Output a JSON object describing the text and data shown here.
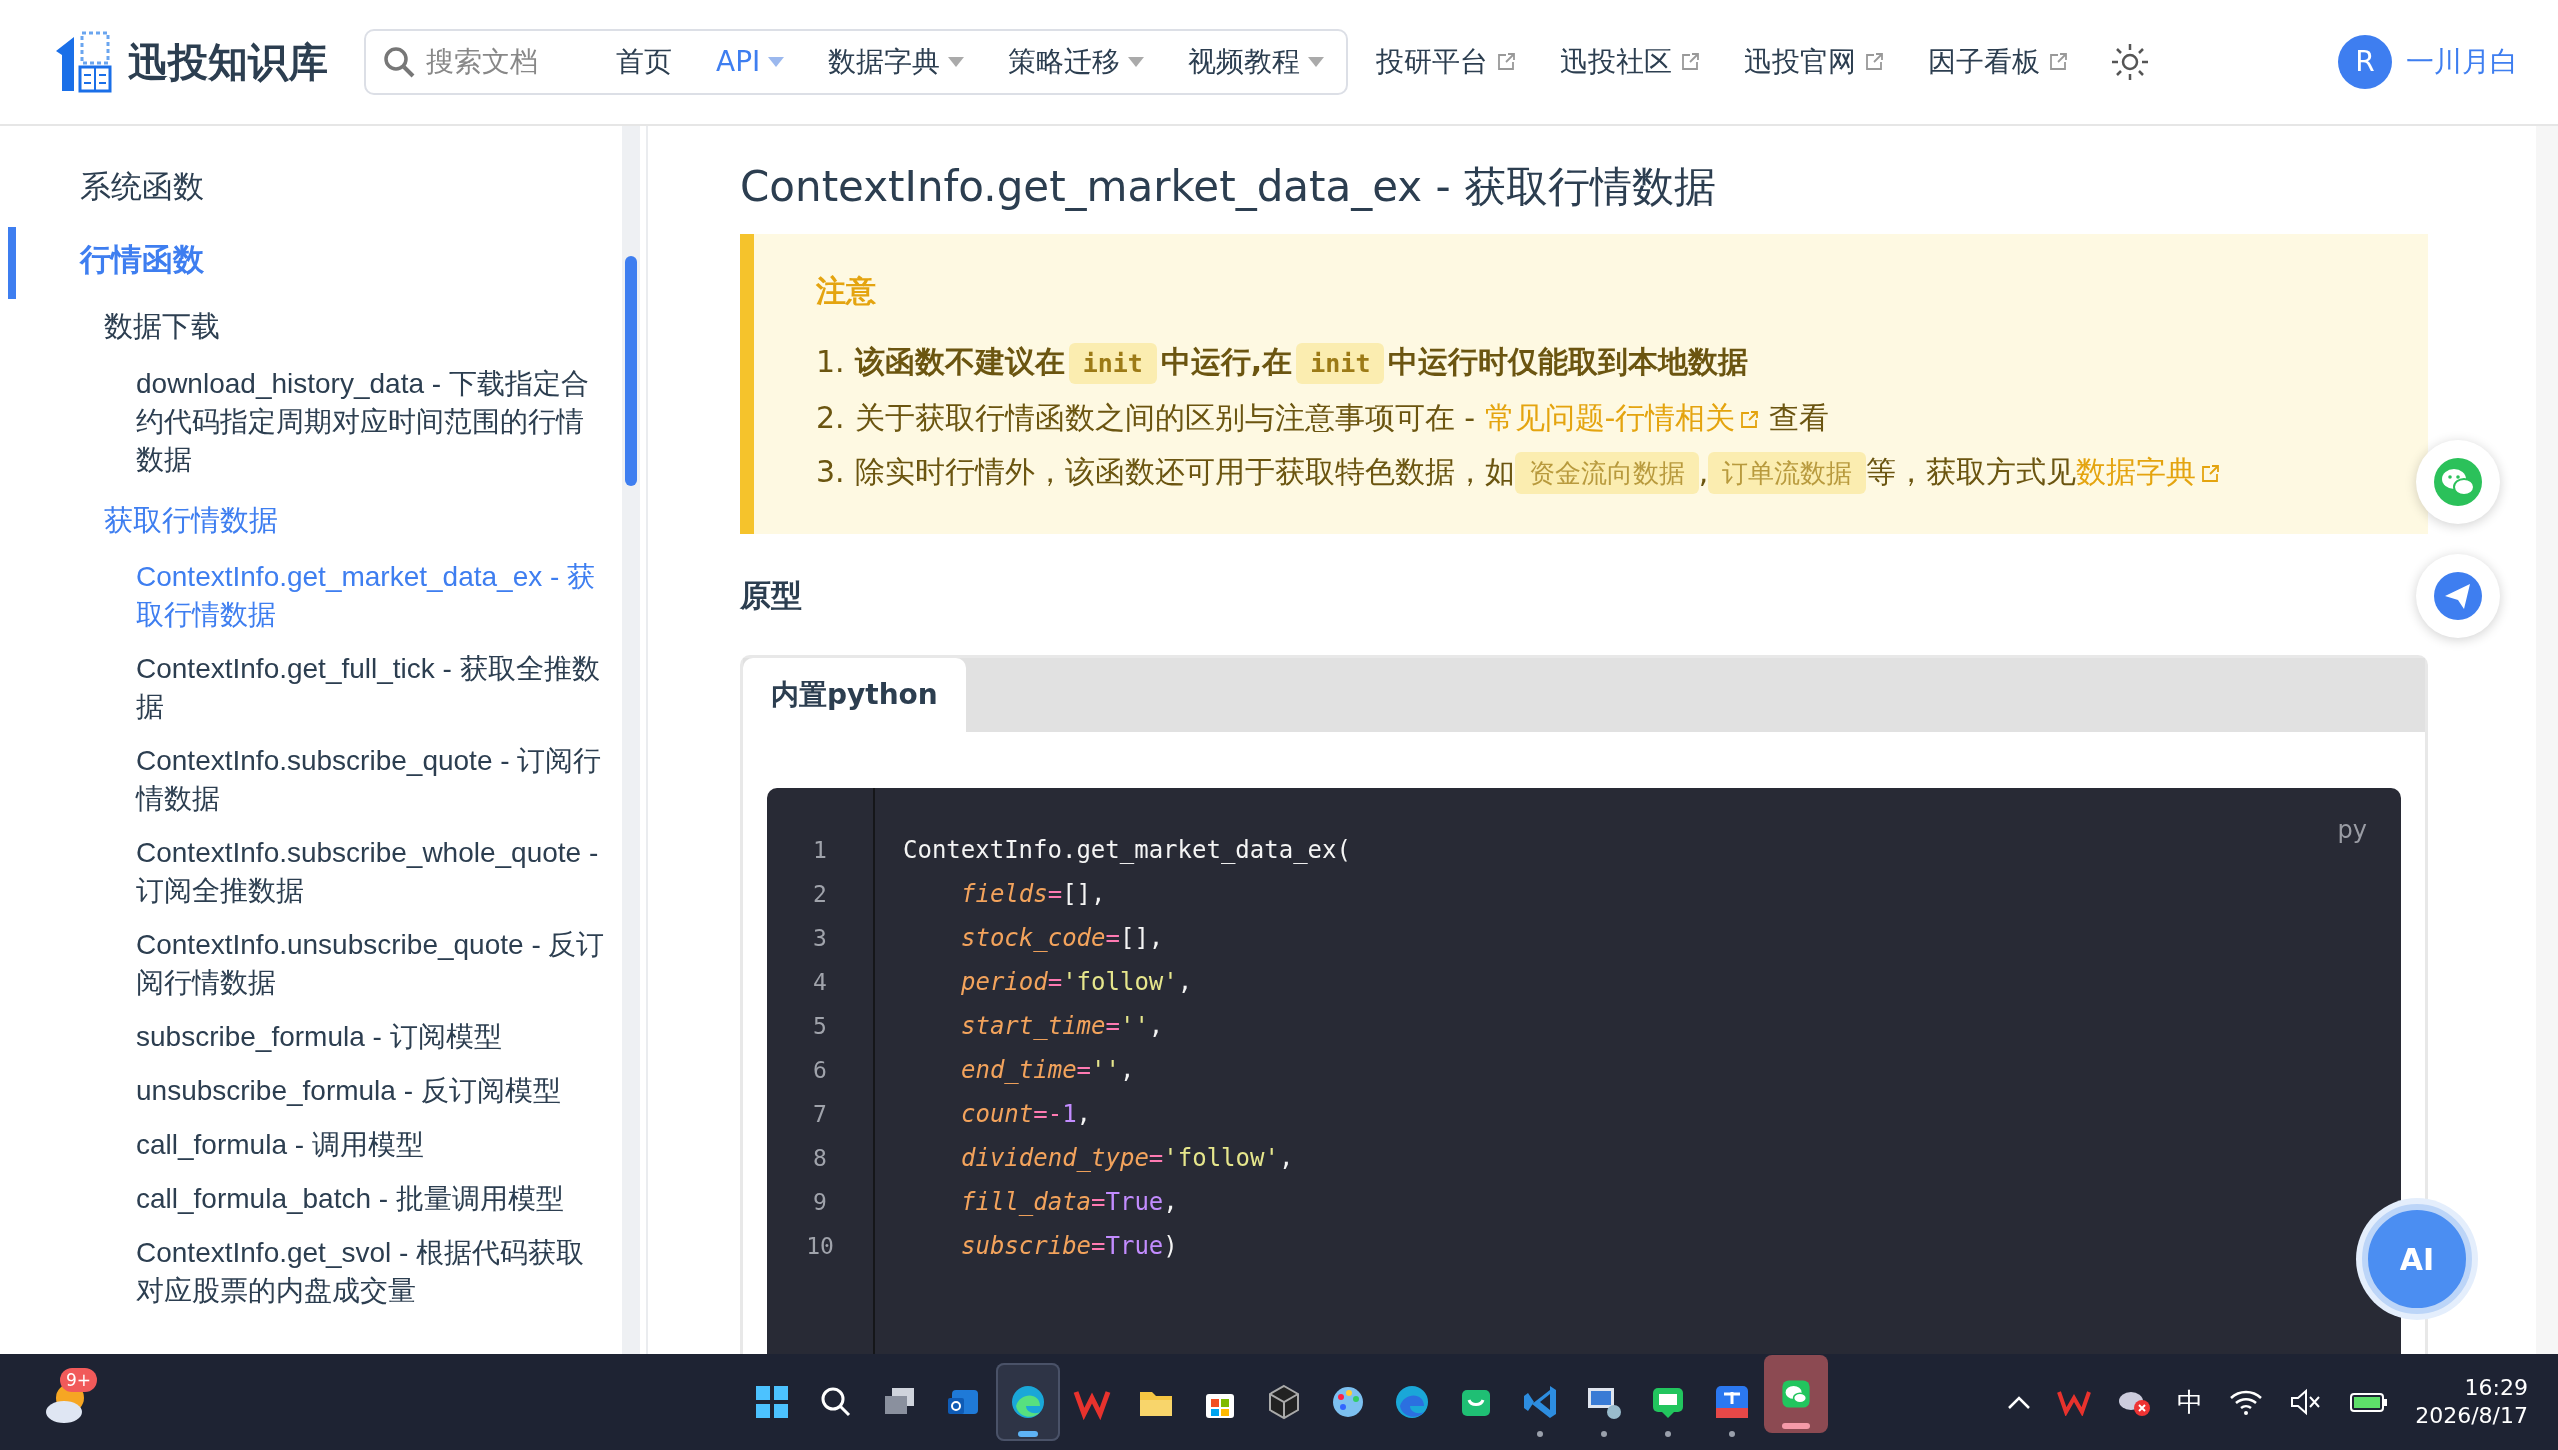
{
  "header": {
    "logo_text": "迅投知识库",
    "search": {
      "placeholder": "搜索文档"
    },
    "nav": [
      {
        "label": "首页",
        "kind": "plain",
        "selected": false
      },
      {
        "label": "API",
        "kind": "dropdown",
        "selected": true
      },
      {
        "label": "数据字典",
        "kind": "dropdown",
        "selected": false
      },
      {
        "label": "策略迁移",
        "kind": "dropdown",
        "selected": false
      },
      {
        "label": "视频教程",
        "kind": "dropdown",
        "selected": false
      },
      {
        "label": "投研平台",
        "kind": "external",
        "selected": false
      },
      {
        "label": "迅投社区",
        "kind": "external",
        "selected": false
      },
      {
        "label": "迅投官网",
        "kind": "external",
        "selected": false
      },
      {
        "label": "因子看板",
        "kind": "external",
        "selected": false
      }
    ],
    "user": {
      "avatar": "R",
      "name": "一川月白"
    }
  },
  "sidebar": {
    "items": [
      {
        "label": "系统函数",
        "selected": false
      },
      {
        "label": "行情函数",
        "selected": true,
        "children": [
          {
            "label": "数据下载",
            "selected": false,
            "children": [
              {
                "label": "download_history_data - 下载指定合约代码指定周期对应时间范围的行情数据",
                "selected": false
              }
            ]
          },
          {
            "label": "获取行情数据",
            "selected": true,
            "children": [
              {
                "label": "ContextInfo.get_market_data_ex - 获取行情数据",
                "selected": true
              },
              {
                "label": "ContextInfo.get_full_tick - 获取全推数据",
                "selected": false
              },
              {
                "label": "ContextInfo.subscribe_quote - 订阅行情数据",
                "selected": false
              },
              {
                "label": "ContextInfo.subscribe_whole_quote - 订阅全推数据",
                "selected": false
              },
              {
                "label": "ContextInfo.unsubscribe_quote - 反订阅行情数据",
                "selected": false
              },
              {
                "label": "subscribe_formula - 订阅模型",
                "selected": false
              },
              {
                "label": "unsubscribe_formula - 反订阅模型",
                "selected": false
              },
              {
                "label": "call_formula - 调用模型",
                "selected": false
              },
              {
                "label": "call_formula_batch - 批量调用模型",
                "selected": false
              },
              {
                "label": "ContextInfo.get_svol - 根据代码获取对应股票的内盘成交量",
                "selected": false
              }
            ]
          }
        ]
      }
    ]
  },
  "main": {
    "title": "ContextInfo.get_market_data_ex - 获取行情数据",
    "notice": {
      "title": "注意",
      "items": [
        {
          "number": "1.",
          "bold": true,
          "segments": [
            {
              "kind": "text",
              "text": "该函数不建议在"
            },
            {
              "kind": "code",
              "text": "init"
            },
            {
              "kind": "text",
              "text": "中运行,在"
            },
            {
              "kind": "code",
              "text": "init"
            },
            {
              "kind": "text",
              "text": "中运行时仅能取到本地数据"
            }
          ]
        },
        {
          "number": "2.",
          "bold": false,
          "segments": [
            {
              "kind": "text",
              "text": "关于获取行情函数之间的区别与注意事项可在 - "
            },
            {
              "kind": "link",
              "text": "常见问题-行情相关"
            },
            {
              "kind": "text",
              "text": " 查看"
            }
          ]
        },
        {
          "number": "3.",
          "bold": false,
          "segments": [
            {
              "kind": "text",
              "text": "除实时行情外，该函数还可用于获取特色数据，如"
            },
            {
              "kind": "tag",
              "text": "资金流向数据"
            },
            {
              "kind": "text",
              "text": ","
            },
            {
              "kind": "tag",
              "text": "订单流数据"
            },
            {
              "kind": "text",
              "text": "等，获取方式见"
            },
            {
              "kind": "link",
              "text": "数据字典"
            }
          ]
        }
      ]
    },
    "section_heading": "原型",
    "code_tabs": [
      {
        "label": "内置python",
        "selected": true
      }
    ],
    "code": {
      "lang": "py",
      "lines": [
        {
          "number": "1",
          "tokens": [
            {
              "kind": "plain",
              "text": "ContextInfo.get_market_data_ex("
            }
          ]
        },
        {
          "number": "2",
          "tokens": [
            {
              "kind": "param",
              "text": "fields"
            },
            {
              "kind": "op",
              "text": "="
            },
            {
              "kind": "plain",
              "text": "[],"
            }
          ]
        },
        {
          "number": "3",
          "tokens": [
            {
              "kind": "param",
              "text": "stock_code"
            },
            {
              "kind": "op",
              "text": "="
            },
            {
              "kind": "plain",
              "text": "[],"
            }
          ]
        },
        {
          "number": "4",
          "tokens": [
            {
              "kind": "param",
              "text": "period"
            },
            {
              "kind": "op",
              "text": "="
            },
            {
              "kind": "string",
              "text": "'follow'"
            },
            {
              "kind": "plain",
              "text": ","
            }
          ]
        },
        {
          "number": "5",
          "tokens": [
            {
              "kind": "param",
              "text": "start_time"
            },
            {
              "kind": "op",
              "text": "="
            },
            {
              "kind": "string",
              "text": "''"
            },
            {
              "kind": "plain",
              "text": ","
            }
          ]
        },
        {
          "number": "6",
          "tokens": [
            {
              "kind": "param",
              "text": "end_time"
            },
            {
              "kind": "op",
              "text": "="
            },
            {
              "kind": "string",
              "text": "''"
            },
            {
              "kind": "plain",
              "text": ","
            }
          ]
        },
        {
          "number": "7",
          "tokens": [
            {
              "kind": "param",
              "text": "count"
            },
            {
              "kind": "op",
              "text": "=-"
            },
            {
              "kind": "number",
              "text": "1"
            },
            {
              "kind": "plain",
              "text": ","
            }
          ]
        },
        {
          "number": "8",
          "tokens": [
            {
              "kind": "param",
              "text": "dividend_type"
            },
            {
              "kind": "op",
              "text": "="
            },
            {
              "kind": "string",
              "text": "'follow'"
            },
            {
              "kind": "plain",
              "text": ","
            }
          ]
        },
        {
          "number": "9",
          "tokens": [
            {
              "kind": "param",
              "text": "fill_data"
            },
            {
              "kind": "op",
              "text": "="
            },
            {
              "kind": "number",
              "text": "True"
            },
            {
              "kind": "plain",
              "text": ","
            }
          ]
        },
        {
          "number": "10",
          "tokens": [
            {
              "kind": "param",
              "text": "subscribe"
            },
            {
              "kind": "op",
              "text": "="
            },
            {
              "kind": "number",
              "text": "True"
            },
            {
              "kind": "plain",
              "text": ")"
            }
          ]
        }
      ]
    }
  },
  "floating": {
    "ai_label": "AI"
  },
  "taskbar": {
    "weather_badge": "9+",
    "apps": [
      {
        "kind": "start",
        "running": false,
        "selected": false
      },
      {
        "kind": "search",
        "running": false,
        "selected": false
      },
      {
        "kind": "taskview",
        "running": false,
        "selected": false
      },
      {
        "kind": "mail",
        "running": false,
        "selected": false
      },
      {
        "kind": "browser",
        "running": true,
        "selected": true
      },
      {
        "kind": "office",
        "running": false,
        "selected": false
      },
      {
        "kind": "folder",
        "running": false,
        "selected": false
      },
      {
        "kind": "store",
        "running": false,
        "selected": false
      },
      {
        "kind": "cube",
        "running": false,
        "selected": false
      },
      {
        "kind": "palette",
        "running": false,
        "selected": false
      },
      {
        "kind": "browser2",
        "running": false,
        "selected": false
      },
      {
        "kind": "bag",
        "running": false,
        "selected": false
      },
      {
        "kind": "code",
        "running": true,
        "selected": false
      },
      {
        "kind": "remote",
        "running": true,
        "selected": false
      },
      {
        "kind": "chat",
        "running": true,
        "selected": false
      },
      {
        "kind": "translate",
        "running": true,
        "selected": false
      },
      {
        "kind": "wechat",
        "running": true,
        "selected": false,
        "alert": true
      }
    ],
    "ime": "中",
    "time": "16:29",
    "date": "2026/8/17"
  }
}
